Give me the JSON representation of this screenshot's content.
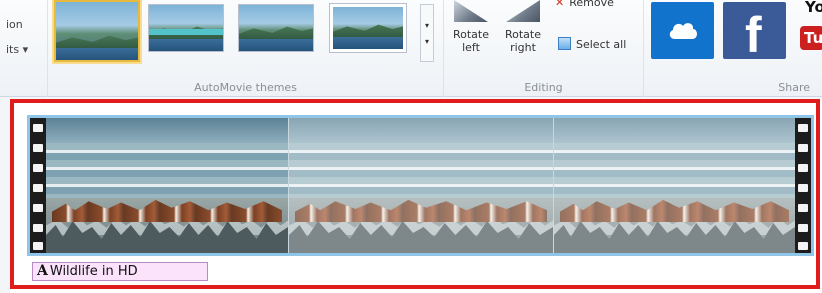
{
  "ribbon": {
    "partial_labels": [
      "ion",
      "its ▾"
    ],
    "themes_group": {
      "label": "AutoMovie themes",
      "thumbnails": [
        {
          "icon": "theme-thumbnail-icon",
          "selected": true
        },
        {
          "icon": "theme-thumbnail-icon",
          "selected": false
        },
        {
          "icon": "theme-thumbnail-icon",
          "selected": false
        },
        {
          "icon": "theme-thumbnail-icon",
          "selected": false
        }
      ],
      "scroll_glyphs": [
        "▾",
        "▾"
      ]
    },
    "editing_group": {
      "label": "Editing",
      "rotate_left": {
        "line1": "Rotate",
        "line2": "left"
      },
      "rotate_right": {
        "line1": "Rotate",
        "line2": "right"
      },
      "remove": "Remove",
      "select_all": "Select all"
    },
    "share_group": {
      "label": "Share",
      "tiles": [
        "onedrive-icon",
        "facebook-icon",
        "youtube-icon"
      ],
      "facebook_glyph": "f",
      "youtube_partial": "Yo",
      "youtube_box": "Tu"
    }
  },
  "storyboard": {
    "selection_color": "#e01d1d",
    "clip_border_color": "#8fc6e8",
    "caption": {
      "icon": "A",
      "text": "Wildlife in HD",
      "background": "#fbe3fb"
    }
  }
}
